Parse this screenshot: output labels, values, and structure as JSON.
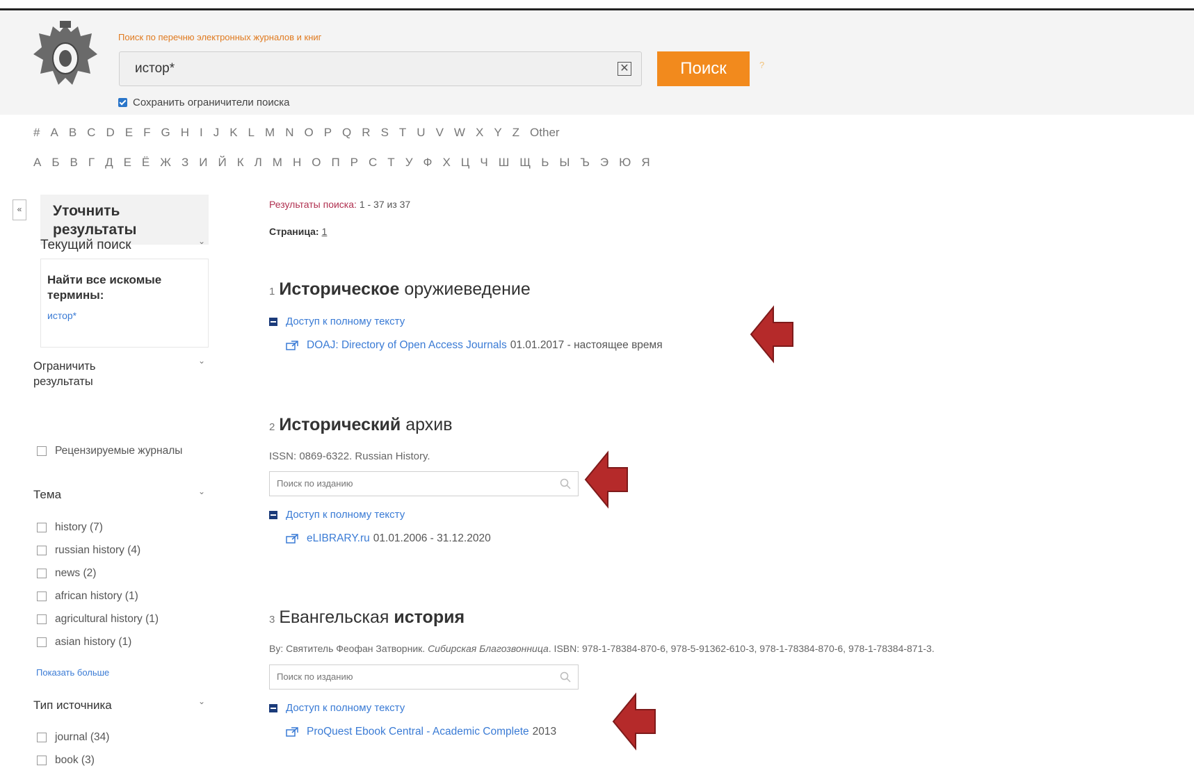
{
  "header": {
    "search_caption": "Поиск по перечню электронных журналов и книг",
    "search_value": "истор*",
    "clear_symbol": "✕",
    "search_button": "Поиск",
    "help_symbol": "?",
    "keep_limiters": "Сохранить ограничители поиска"
  },
  "alphabet": {
    "latin": [
      "#",
      "A",
      "B",
      "C",
      "D",
      "E",
      "F",
      "G",
      "H",
      "I",
      "J",
      "K",
      "L",
      "M",
      "N",
      "O",
      "P",
      "Q",
      "R",
      "S",
      "T",
      "U",
      "V",
      "W",
      "X",
      "Y",
      "Z",
      "Other"
    ],
    "cyrillic": [
      "А",
      "Б",
      "В",
      "Г",
      "Д",
      "Е",
      "Ё",
      "Ж",
      "З",
      "И",
      "Й",
      "К",
      "Л",
      "М",
      "Н",
      "О",
      "П",
      "Р",
      "С",
      "Т",
      "У",
      "Ф",
      "Х",
      "Ц",
      "Ч",
      "Ш",
      "Щ",
      "Ь",
      "Ы",
      "Ъ",
      "Э",
      "Ю",
      "Я"
    ]
  },
  "sidebar": {
    "collapse_symbol": "«",
    "refine_title": "Уточнить результаты",
    "current_search": "Текущий поиск",
    "find_all": "Найти все искомые термины:",
    "term": "истор*",
    "limit_title": "Ограничить результаты",
    "peer_reviewed": "Рецензируемые журналы",
    "subject_title": "Тема",
    "subjects": [
      "history (7)",
      "russian history (4)",
      "news (2)",
      "african history (1)",
      "agricultural history (1)",
      "asian history (1)"
    ],
    "show_more": "Показать больше",
    "source_type_title": "Тип источника",
    "source_types": [
      "journal (34)",
      "book (3)"
    ]
  },
  "results": {
    "count_label": "Результаты поиска:",
    "count_value": "1 - 37 из 37",
    "page_label": "Страница:",
    "page_number": "1",
    "items": [
      {
        "num": "1",
        "title_bold": "Историческое",
        "title_rest": " оружиеведение",
        "access": "Доступ к полному тексту",
        "provider_link": "DOAJ: Directory of Open Access Journals",
        "provider_dates": "01.01.2017 - настоящее время"
      },
      {
        "num": "2",
        "title_bold": "Исторический",
        "title_rest": " архив",
        "meta": "ISSN: 0869-6322. Russian History.",
        "pub_search_placeholder": "Поиск по изданию",
        "access": "Доступ к полному тексту",
        "provider_link": "eLIBRARY.ru",
        "provider_dates": "01.01.2006 - 31.12.2020"
      },
      {
        "num": "3",
        "title_rest_first": "Евангельская ",
        "title_bold": "история",
        "meta_author": "By: Святитель Феофан Затворник.",
        "meta_publisher": "Сибирская Благозвонница",
        "meta_isbn": ". ISBN: 978-1-78384-870-6, 978-5-91362-610-3, 978-1-78384-870-6, 978-1-78384-871-3.",
        "pub_search_placeholder": "Поиск по изданию",
        "access": "Доступ к полному тексту",
        "provider_link": "ProQuest Ebook Central - Academic Complete",
        "provider_dates": "2013"
      }
    ]
  },
  "colors": {
    "accent_orange": "#f28a1d",
    "link_blue": "#3a7bd5",
    "arrow_red": "#b52a2a"
  }
}
